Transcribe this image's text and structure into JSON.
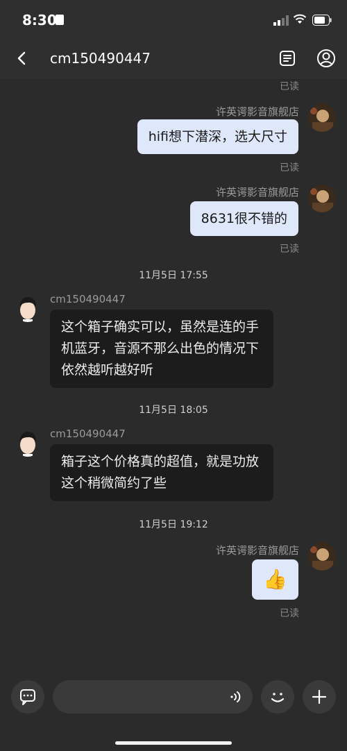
{
  "status_bar": {
    "time": "8:30"
  },
  "nav": {
    "title": "cm150490447"
  },
  "messages": {
    "top_read": "已读",
    "m1": {
      "sender": "许英谔影音旗舰店",
      "text": "hifi想下潜深，选大尺寸",
      "read": "已读"
    },
    "m2": {
      "sender": "许英谔影音旗舰店",
      "text": "8631很不错的",
      "read": "已读"
    },
    "ts1": "11月5日 17:55",
    "m3": {
      "sender": "cm150490447",
      "text": "这个箱子确实可以，虽然是连的手机蓝牙，音源不那么出色的情况下依然越听越好听"
    },
    "ts2": "11月5日 18:05",
    "m4": {
      "sender": "cm150490447",
      "text": "箱子这个价格真的超值，就是功放这个稍微简约了些"
    },
    "ts3": "11月5日 19:12",
    "m5": {
      "sender": "许英谔影音旗舰店",
      "emoji": "👍",
      "read": "已读"
    }
  },
  "colors": {
    "background": "#2b2b2b",
    "outgoing_bubble": "#dfe8fb",
    "incoming_bubble": "#1c1c1c"
  },
  "icons": [
    "back-icon",
    "document-icon",
    "user-icon",
    "chat-icon",
    "voice-icon",
    "emoji-icon",
    "plus-icon"
  ]
}
